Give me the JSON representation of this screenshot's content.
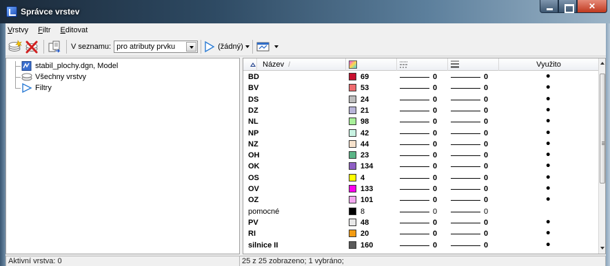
{
  "window": {
    "title": "Správce vrstev"
  },
  "menu": [
    {
      "label": "Vrstvy"
    },
    {
      "label": "Filtr"
    },
    {
      "label": "Editovat"
    }
  ],
  "toolbar": {
    "list_label": "V seznamu:",
    "list_value": "pro atributy prvku",
    "filter_value": "(žádný)"
  },
  "tree": [
    {
      "label": "stabil_plochy.dgn, Model",
      "icon": "dgn-model-icon"
    },
    {
      "label": "Všechny vrstvy",
      "icon": "all-layers-icon"
    },
    {
      "label": "Filtry",
      "icon": "filter-icon"
    }
  ],
  "table": {
    "columns": {
      "name": "Název",
      "color_icon": "color-icon",
      "style_icon": "line-style-icon",
      "weight_icon": "line-weight-icon",
      "used": "Využito"
    },
    "rows": [
      {
        "name": "BD",
        "color": 69,
        "hex": "#c8102e",
        "style": "0",
        "weight": "0",
        "used": true,
        "bold": true
      },
      {
        "name": "BV",
        "color": 53,
        "hex": "#ee6b6e",
        "style": "0",
        "weight": "0",
        "used": true,
        "bold": true
      },
      {
        "name": "DS",
        "color": 24,
        "hex": "#bdbdbd",
        "style": "0",
        "weight": "0",
        "used": true,
        "bold": true
      },
      {
        "name": "DZ",
        "color": 21,
        "hex": "#b8b4d8",
        "style": "0",
        "weight": "0",
        "used": true,
        "bold": true
      },
      {
        "name": "NL",
        "color": 98,
        "hex": "#a8f09a",
        "style": "0",
        "weight": "0",
        "used": true,
        "bold": true
      },
      {
        "name": "NP",
        "color": 42,
        "hex": "#c8f2e2",
        "style": "0",
        "weight": "0",
        "used": true,
        "bold": true
      },
      {
        "name": "NZ",
        "color": 44,
        "hex": "#f7e2cc",
        "style": "0",
        "weight": "0",
        "used": true,
        "bold": true
      },
      {
        "name": "OH",
        "color": 23,
        "hex": "#5bb587",
        "style": "0",
        "weight": "0",
        "used": true,
        "bold": true
      },
      {
        "name": "OK",
        "color": 134,
        "hex": "#8e5fc4",
        "style": "0",
        "weight": "0",
        "used": true,
        "bold": true
      },
      {
        "name": "OS",
        "color": 4,
        "hex": "#ffff00",
        "style": "0",
        "weight": "0",
        "used": true,
        "bold": true
      },
      {
        "name": "OV",
        "color": 133,
        "hex": "#ff00ee",
        "style": "0",
        "weight": "0",
        "used": true,
        "bold": true
      },
      {
        "name": "OZ",
        "color": 101,
        "hex": "#f3a8f0",
        "style": "0",
        "weight": "0",
        "used": true,
        "bold": true
      },
      {
        "name": "pomocné",
        "color": 8,
        "hex": "#000000",
        "style": "0",
        "weight": "0",
        "used": false,
        "bold": false
      },
      {
        "name": "PV",
        "color": 48,
        "hex": "#e8e8e8",
        "style": "0",
        "weight": "0",
        "used": true,
        "bold": true
      },
      {
        "name": "RI",
        "color": 20,
        "hex": "#f39c12",
        "style": "0",
        "weight": "0",
        "used": true,
        "bold": true
      },
      {
        "name": "silnice II",
        "color": 160,
        "hex": "#5a5a5a",
        "style": "0",
        "weight": "0",
        "used": true,
        "bold": true
      }
    ]
  },
  "status": {
    "active_layer": "Aktivní vrstva: 0",
    "summary": "25 z 25 zobrazeno; 1 vybráno;"
  }
}
